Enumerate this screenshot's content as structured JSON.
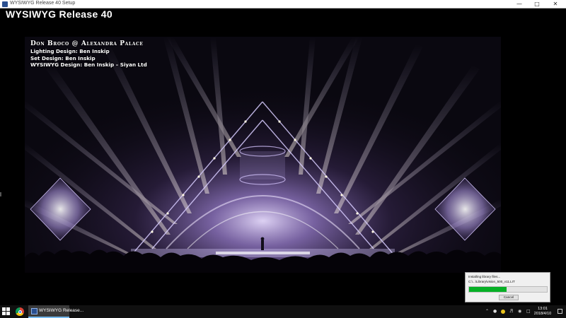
{
  "window": {
    "title": "WYSIWYG Release 40 Setup",
    "minimize_icon": "minimize-icon",
    "maximize_icon": "maximize-icon",
    "close_icon": "close-icon"
  },
  "heading": "WYSIWYG Release 40",
  "hero": {
    "show_title": "Don Broco @ Alexandra Palace",
    "credits": [
      "Lighting Design: Ben Inskip",
      "Set Design: Ben Inskip",
      "WYSIWYG Design: Ben Inskip – Siyan Ltd"
    ]
  },
  "installer": {
    "status": "Installing library files...",
    "file": "C:\\...\\Library\\vision_500_v11.LIT",
    "progress": 0.48,
    "cancel_label": "Cancel"
  },
  "taskbar": {
    "start_icon": "windows-start-icon",
    "browser_icon": "chrome-icon",
    "app_label": "WYSIWYG Release...",
    "tray_icons": [
      "chevron-up-icon",
      "network-icon",
      "folder-icon",
      "volume-icon",
      "wifi-icon",
      "language-icon"
    ],
    "time": "13:01",
    "date": "2018/4/10"
  },
  "colors": {
    "progress_fill": "#06b025",
    "stage_light": "#c9b6ff",
    "taskbar": "#101010"
  }
}
